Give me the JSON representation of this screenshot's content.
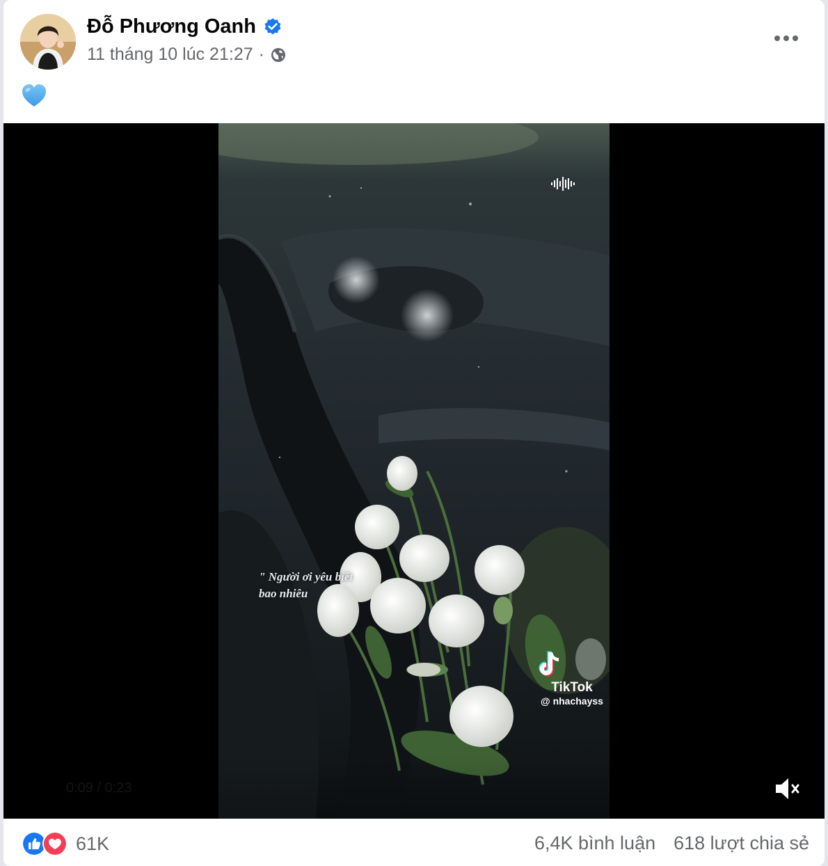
{
  "post": {
    "author": "Đỗ Phương Oanh",
    "timestamp": "11 tháng 10 lúc 21:27",
    "separator": "·",
    "caption_emoji": "blue-heart-icon",
    "privacy_icon": "globe-icon"
  },
  "video": {
    "overlay_line1": "\" Người ơi yêu biết",
    "overlay_line2": "bao nhiêu",
    "watermark_brand": "TikTok",
    "watermark_handle": "@ nhachayss",
    "timecode": "0:09 / 0:23",
    "muted": true
  },
  "footer": {
    "reaction_count": "61K",
    "comments": "6,4K bình luận",
    "shares": "618 lượt chia sẻ"
  },
  "colors": {
    "verified_blue": "#1877f2",
    "like_blue": "#1877f2",
    "love_red": "#f33e58",
    "muted_text": "#65676b"
  }
}
